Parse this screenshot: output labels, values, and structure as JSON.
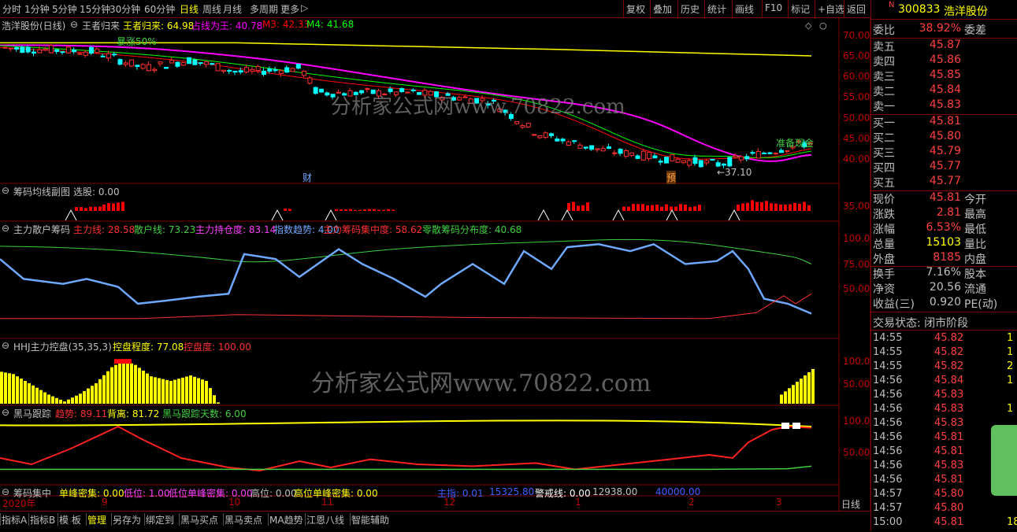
{
  "toolbar": {
    "periods": [
      "分时",
      "1分钟",
      "5分钟",
      "15分钟",
      "30分钟",
      "60分钟",
      "日线",
      "周线",
      "月线",
      "多周期",
      "更多"
    ],
    "active_period": "日线",
    "right_buttons": [
      "复权",
      "叠加",
      "历史",
      "统计",
      "画线",
      "F10",
      "标记",
      "+自选",
      "返回"
    ]
  },
  "main_panel": {
    "stock_title": "浩洋股份(日线)",
    "indicator_name": "王者归来",
    "indicators": [
      {
        "label": "王者归来: 64.98",
        "color": "#ffff00"
      },
      {
        "label": "占线为王: 40.78",
        "color": "#ff00ff"
      },
      {
        "label": "M3: 42.33",
        "color": "#ff0000"
      },
      {
        "label": "M4: 41.68",
        "color": "#00ff00"
      }
    ],
    "y_ticks": [
      "70.00",
      "65.00",
      "60.00",
      "55.00",
      "50.00",
      "45.00",
      "40.00"
    ],
    "low_annotation": "←37.10",
    "annot_left": "暴涨50%",
    "annot_right": "准备现金",
    "badge_cai": "财",
    "badge_yu": "预"
  },
  "panel2": {
    "name": "筹码均线副图",
    "values": [
      {
        "label": "选股: 0.00",
        "color": "#c0c0c0"
      }
    ],
    "y_ticks": [
      "35.00"
    ]
  },
  "panel3": {
    "name": "主力散户筹码",
    "values": [
      {
        "label": "主力线: 28.58",
        "color": "#ff3030"
      },
      {
        "label": "散户线: 73.23",
        "color": "#40d040"
      },
      {
        "label": "主力持仓度: 83.14",
        "color": "#ff40ff"
      },
      {
        "label": "指数趋势: 4.00",
        "color": "#6fa8ff"
      },
      {
        "label": "主力筹码集中度: 58.62",
        "color": "#ff3030"
      },
      {
        "label": "零散筹码分布度: 40.68",
        "color": "#40d040"
      }
    ],
    "y_ticks": [
      "100.0",
      "75.00",
      "50.00"
    ]
  },
  "panel4": {
    "name": "HHJ主力控盘(35,35,3)",
    "values": [
      {
        "label": "控盘程度: 77.08",
        "color": "#ffff00"
      },
      {
        "label": "控盘度: 100.00",
        "color": "#ff3030"
      }
    ],
    "y_ticks": [
      "100.0",
      "50.00"
    ]
  },
  "panel5": {
    "name": "黑马跟踪",
    "values": [
      {
        "label": "趋势: 89.11",
        "color": "#ff3030"
      },
      {
        "label": "背离: 81.72",
        "color": "#ffff00"
      },
      {
        "label": "黑马跟踪天数: 6.00",
        "color": "#40d040"
      }
    ],
    "y_ticks": [
      "100.0",
      "50.00"
    ]
  },
  "panel6": {
    "name": "筹码集中",
    "values": [
      {
        "label": "单峰密集: 0.00",
        "color": "#ffff00"
      },
      {
        "label": "低位: 1.00",
        "color": "#ff40ff"
      },
      {
        "label": "低位单峰密集: 0.00",
        "color": "#ff40ff"
      },
      {
        "label": "高位: 0.00",
        "color": "#c0c0c0"
      },
      {
        "label": "高位单峰密集: 0.00",
        "color": "#ffff00"
      }
    ],
    "index_values": [
      {
        "label": "主指: 0.01",
        "color": "#4060ff"
      },
      {
        "label": "15325.80",
        "color": "#4060ff"
      },
      {
        "label": "警戒线: 0.00",
        "color": "#ffffff"
      },
      {
        "label": "12938.00",
        "color": "#c0c0c0"
      },
      {
        "label": "40000.00",
        "color": "#4060ff"
      }
    ]
  },
  "date_axis": {
    "labels": [
      "2020年",
      "9",
      "10",
      "11",
      "12",
      "1",
      "2",
      "3"
    ],
    "period_button": "日线",
    "plus": "+",
    "minus": "−"
  },
  "bottom_tabs": [
    "指标A",
    "指标B",
    "模 板",
    "管理",
    "另存为",
    "绑定到",
    "黑马买点",
    "黑马卖点",
    "MA趋势",
    "江恩八线",
    "智能辅助"
  ],
  "active_bottom_tab": "管理",
  "watermark": "分析家公式网www.70822.com",
  "quote": {
    "code": "300833",
    "name": "浩洋股份",
    "n_mark": "N",
    "weibi": {
      "l": "委比",
      "v": "38.92%",
      "r": "委差"
    },
    "sells": [
      {
        "l": "卖五",
        "v": "45.87"
      },
      {
        "l": "卖四",
        "v": "45.86"
      },
      {
        "l": "卖三",
        "v": "45.85"
      },
      {
        "l": "卖二",
        "v": "45.84"
      },
      {
        "l": "卖一",
        "v": "45.83"
      }
    ],
    "buys": [
      {
        "l": "买一",
        "v": "45.81"
      },
      {
        "l": "买二",
        "v": "45.80"
      },
      {
        "l": "买三",
        "v": "45.79"
      },
      {
        "l": "买四",
        "v": "45.77"
      },
      {
        "l": "买五",
        "v": "45.77"
      }
    ],
    "stats": [
      {
        "l": "现价",
        "v": "45.81",
        "r": "今开",
        "c": "#ff4040"
      },
      {
        "l": "涨跌",
        "v": "2.81",
        "r": "最高",
        "c": "#ff4040"
      },
      {
        "l": "涨幅",
        "v": "6.53%",
        "r": "最低",
        "c": "#ff4040"
      },
      {
        "l": "总量",
        "v": "15103",
        "r": "量比",
        "c": "#ffff00"
      },
      {
        "l": "外盘",
        "v": "8185",
        "r": "内盘",
        "c": "#ff4040"
      },
      {
        "l": "换手",
        "v": "7.16%",
        "r": "股本",
        "c": "#c0c0c0"
      },
      {
        "l": "净资",
        "v": "20.56",
        "r": "流通",
        "c": "#c0c0c0"
      },
      {
        "l": "收益(三)",
        "v": "0.920",
        "r": "PE(动)",
        "c": "#c0c0c0"
      }
    ],
    "status": "交易状态: 闭市阶段",
    "ticks": [
      {
        "t": "14:55",
        "p": "45.82",
        "v": "1"
      },
      {
        "t": "14:55",
        "p": "45.82",
        "v": "1"
      },
      {
        "t": "14:55",
        "p": "45.82",
        "v": "2"
      },
      {
        "t": "14:56",
        "p": "45.84",
        "v": "1"
      },
      {
        "t": "14:56",
        "p": "45.83",
        "v": ""
      },
      {
        "t": "14:56",
        "p": "45.83",
        "v": "1"
      },
      {
        "t": "14:56",
        "p": "45.83",
        "v": ""
      },
      {
        "t": "14:56",
        "p": "45.81",
        "v": ""
      },
      {
        "t": "14:56",
        "p": "45.81",
        "v": ""
      },
      {
        "t": "14:56",
        "p": "45.83",
        "v": ""
      },
      {
        "t": "14:56",
        "p": "45.81",
        "v": ""
      },
      {
        "t": "14:57",
        "p": "45.80",
        "v": ""
      },
      {
        "t": "14:57",
        "p": "45.80",
        "v": ""
      },
      {
        "t": "15:00",
        "p": "45.81",
        "v": "18"
      }
    ]
  }
}
